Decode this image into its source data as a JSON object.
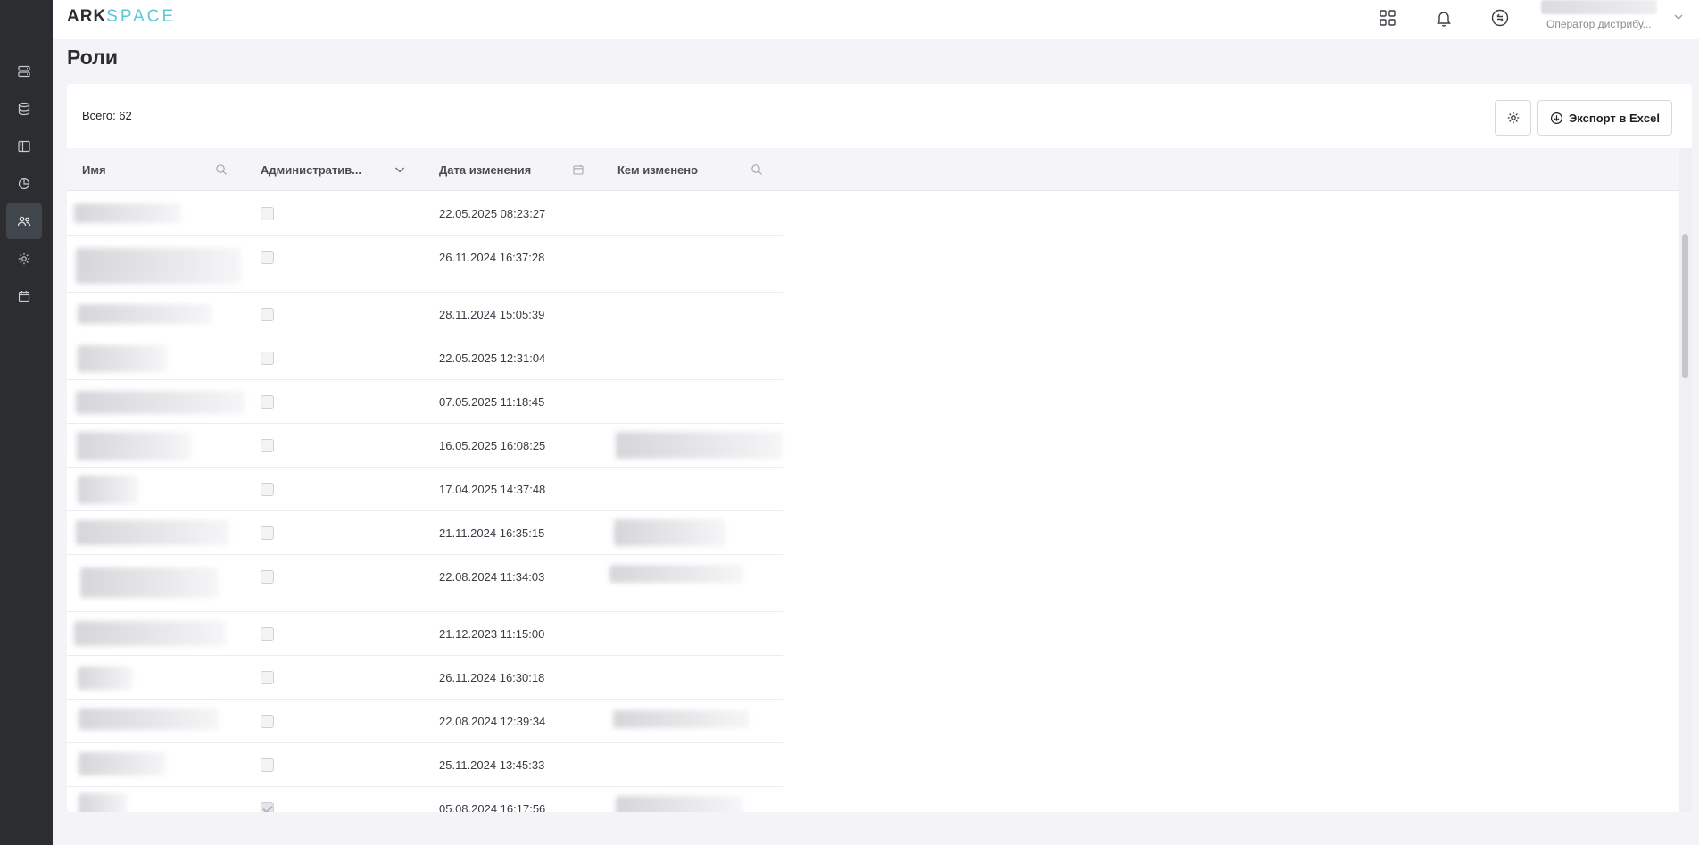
{
  "brand": {
    "part1": "ARK",
    "part2": "SPACE",
    "accent": "#5bc8d6"
  },
  "user": {
    "role": "Оператор дистрибу..."
  },
  "sidebar": {
    "items": [
      {
        "icon": "server-icon",
        "active": false
      },
      {
        "icon": "database-icon",
        "active": false
      },
      {
        "icon": "layout-icon",
        "active": false
      },
      {
        "icon": "chart-pie-icon",
        "active": false
      },
      {
        "icon": "users-icon",
        "active": true
      },
      {
        "icon": "gear-icon",
        "active": false
      },
      {
        "icon": "calendar-icon",
        "active": false
      }
    ]
  },
  "page": {
    "title": "Роли"
  },
  "toolbar": {
    "total": "Всего: 62",
    "export_label": "Экспорт в Excel"
  },
  "table": {
    "columns": [
      {
        "label": "Имя",
        "icon": "search-icon"
      },
      {
        "label": "Административ...",
        "icon": "chevron-down-icon"
      },
      {
        "label": "Дата изменения",
        "icon": "calendar-icon"
      },
      {
        "label": "Кем изменено",
        "icon": "search-icon"
      }
    ],
    "rows": [
      {
        "date": "22.05.2025 08:23:27",
        "admin": false
      },
      {
        "date": "26.11.2024 16:37:28",
        "admin": false
      },
      {
        "date": "28.11.2024 15:05:39",
        "admin": false
      },
      {
        "date": "22.05.2025 12:31:04",
        "admin": false
      },
      {
        "date": "07.05.2025 11:18:45",
        "admin": false
      },
      {
        "date": "16.05.2025 16:08:25",
        "admin": false
      },
      {
        "date": "17.04.2025 14:37:48",
        "admin": false
      },
      {
        "date": "21.11.2024 16:35:15",
        "admin": false
      },
      {
        "date": "22.08.2024 11:34:03",
        "admin": false
      },
      {
        "date": "21.12.2023 11:15:00",
        "admin": false
      },
      {
        "date": "26.11.2024 16:30:18",
        "admin": false
      },
      {
        "date": "22.08.2024 12:39:34",
        "admin": false
      },
      {
        "date": "25.11.2024 13:45:33",
        "admin": false
      },
      {
        "date": "05.08.2024 16:17:56",
        "admin": true
      }
    ]
  }
}
